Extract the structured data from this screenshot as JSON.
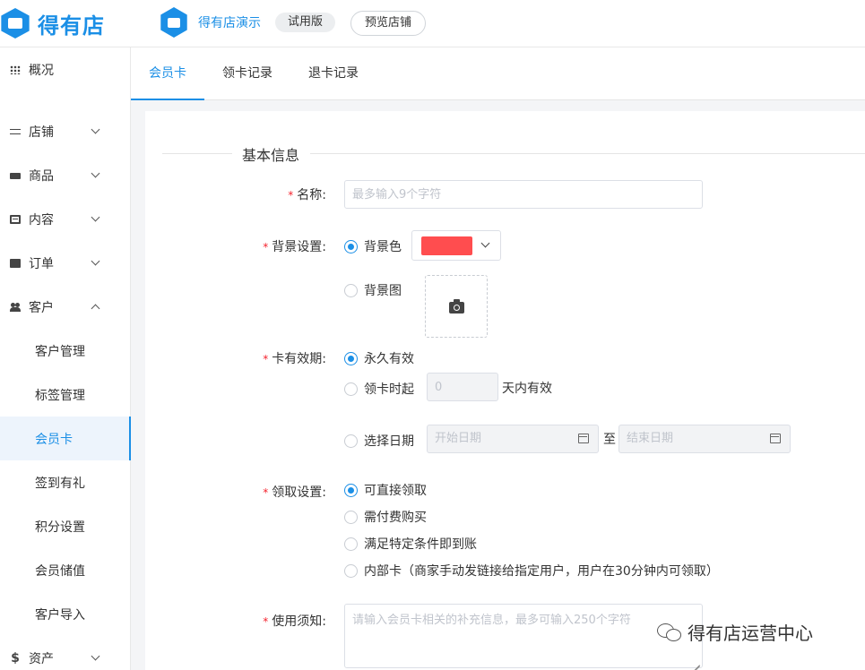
{
  "header": {
    "logo_text": "得有店",
    "shop_name": "得有店演示",
    "trial_badge": "试用版",
    "preview_button": "预览店铺"
  },
  "sidebar": {
    "overview": "概况",
    "store": "店铺",
    "products": "商品",
    "content": "内容",
    "orders": "订单",
    "customers": "客户",
    "customer_sub": [
      "客户管理",
      "标签管理",
      "会员卡",
      "签到有礼",
      "积分设置",
      "会员储值",
      "客户导入"
    ],
    "assets": "资产"
  },
  "tabs": [
    "会员卡",
    "领卡记录",
    "退卡记录"
  ],
  "form": {
    "section_title": "基本信息",
    "name_label": "名称:",
    "name_placeholder": "最多输入9个字符",
    "background_label": "背景设置:",
    "bg_color_option": "背景色",
    "bg_image_option": "背景图",
    "bg_color_value": "#ff4d4f",
    "validity_label": "卡有效期:",
    "validity_forever": "永久有效",
    "validity_from_claim": "领卡时起",
    "days_value": "0",
    "days_suffix": "天内有效",
    "validity_date_range": "选择日期",
    "start_date_placeholder": "开始日期",
    "date_separator": "至",
    "end_date_placeholder": "结束日期",
    "claim_label": "领取设置:",
    "claim_direct": "可直接领取",
    "claim_paid": "需付费购买",
    "claim_condition": "满足特定条件即到账",
    "claim_internal": "内部卡（商家手动发链接给指定用户，用户在30分钟内可领取）",
    "notice_label": "使用须知:",
    "notice_placeholder": "请输入会员卡相关的补充信息，最多可输入250个字符"
  },
  "watermark": "得有店运营中心",
  "accent_color": "#1b8fe6"
}
